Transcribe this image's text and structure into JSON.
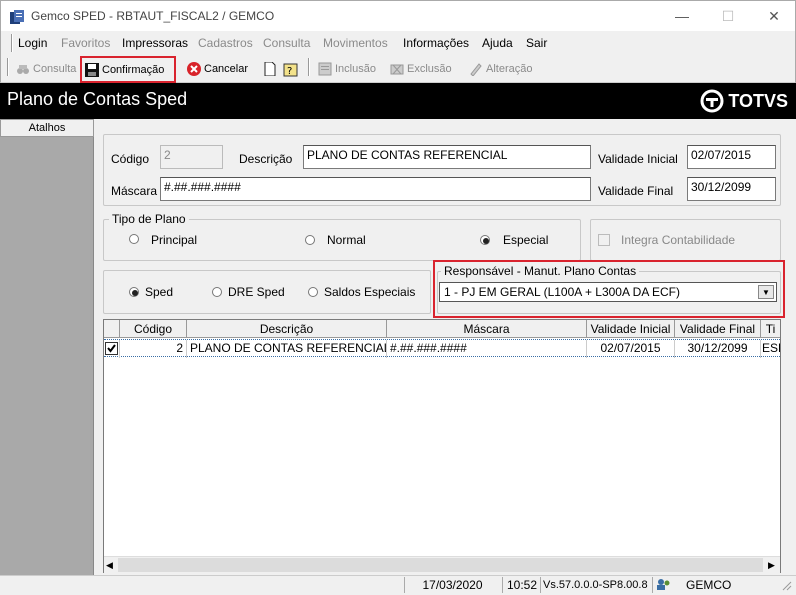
{
  "window": {
    "title": "Gemco SPED - RBTAUT_FISCAL2 / GEMCO",
    "minimize": "—",
    "maximize": "☐",
    "close": "✕"
  },
  "menu": {
    "items": [
      {
        "label": "Login",
        "enabled": true
      },
      {
        "label": "Favoritos",
        "enabled": false
      },
      {
        "label": "Impressoras",
        "enabled": true
      },
      {
        "label": "Cadastros",
        "enabled": false
      },
      {
        "label": "Consulta",
        "enabled": false
      },
      {
        "label": "Movimentos",
        "enabled": false
      },
      {
        "label": "Informações",
        "enabled": true
      },
      {
        "label": "Ajuda",
        "enabled": true
      },
      {
        "label": "Sair",
        "enabled": true
      }
    ]
  },
  "toolbar": {
    "consulta": "Consulta",
    "confirmacao": "Confirmação",
    "cancelar": "Cancelar",
    "inclusao": "Inclusão",
    "exclusao": "Exclusão",
    "alteracao": "Alteração"
  },
  "header": {
    "title": "Plano de Contas Sped",
    "logo_text": "TOTVS"
  },
  "sidebar": {
    "title": "Atalhos"
  },
  "form": {
    "codigo_label": "Código",
    "codigo_value": "2",
    "descricao_label": "Descrição",
    "descricao_value": "PLANO DE CONTAS REFERENCIAL",
    "validade_inicial_label": "Validade Inicial",
    "validade_inicial_value": "02/07/2015",
    "mascara_label": "Máscara",
    "mascara_value": "#.##.###.####",
    "validade_final_label": "Validade Final",
    "validade_final_value": "30/12/2099"
  },
  "tipo_plano": {
    "title": "Tipo de Plano",
    "options": [
      {
        "label": "Principal",
        "checked": false
      },
      {
        "label": "Normal",
        "checked": false
      },
      {
        "label": "Especial",
        "checked": true
      }
    ]
  },
  "integra": {
    "label": "Integra Contabilidade",
    "checked": false
  },
  "sped_options": [
    {
      "label": "Sped",
      "checked": true
    },
    {
      "label": "DRE Sped",
      "checked": false
    },
    {
      "label": "Saldos Especiais",
      "checked": false
    }
  ],
  "responsavel": {
    "title": "Responsável - Manut. Plano Contas",
    "selected": "1  - PJ EM GERAL (L100A + L300A DA ECF)"
  },
  "grid": {
    "columns": [
      "Código",
      "Descrição",
      "Máscara",
      "Validade Inicial",
      "Validade Final",
      "Ti"
    ],
    "rows": [
      {
        "checked": true,
        "codigo": "2",
        "descricao": "PLANO DE CONTAS REFERENCIAL",
        "mascara": "#.##.###.####",
        "validade_inicial": "02/07/2015",
        "validade_final": "30/12/2099",
        "tipo": "ESP"
      }
    ]
  },
  "status": {
    "date": "17/03/2020",
    "time": "10:52",
    "version": "Vs.57.0.0.0-SP8.00.8",
    "company": "GEMCO"
  },
  "colors": {
    "highlight": "#d9232e",
    "header_bg": "#000000",
    "sidebar_bg": "#a9a9a9"
  }
}
